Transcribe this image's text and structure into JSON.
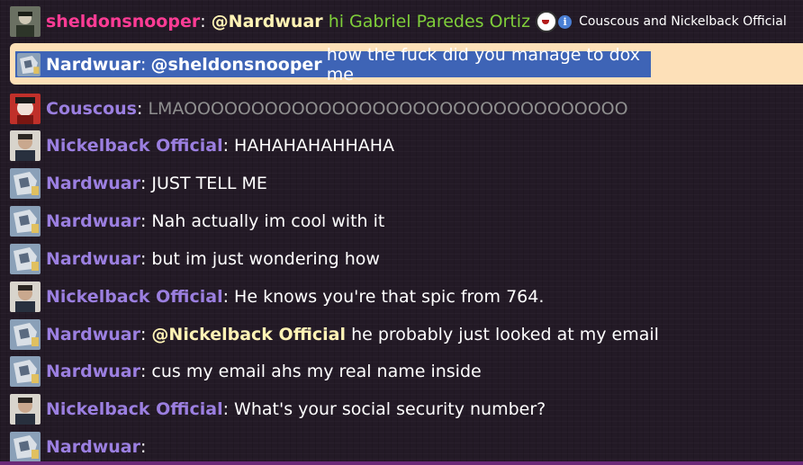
{
  "messages": [
    {
      "user": "sheldonsnooper",
      "mention": "@Nardwuar",
      "text": "hi Gabriel Paredes Ortiz",
      "note": "Couscous and Nickelback Official",
      "avatar_icon": "profile-avatar-icon",
      "emoji_icon": "laughing-emoji-icon",
      "info_icon": "info-badge-icon"
    },
    {
      "user": "Nardwuar",
      "mention": "@sheldonsnooper",
      "text": "how the fuck did you manage to dox me",
      "selected": true,
      "reply_bg": "#fde0b8",
      "highlight": "#3e64b6"
    },
    {
      "user": "Couscous",
      "text": "LMAOOOOOOOOOOOOOOOOOOOOOOOOOOOOOOOOO"
    },
    {
      "user": "Nickelback Official",
      "text": "HAHAHAHAHHAHA"
    },
    {
      "user": "Nardwuar",
      "text": "JUST TELL ME"
    },
    {
      "user": "Nardwuar",
      "text": "Nah actually im cool with it"
    },
    {
      "user": "Nardwuar",
      "text": "but im just wondering how"
    },
    {
      "user": "Nickelback Official",
      "text": "He knows you're that spic from 764."
    },
    {
      "user": "Nardwuar",
      "mention": "@Nickelback Official",
      "text": "he probably just looked at my email"
    },
    {
      "user": "Nardwuar",
      "text": "cus my email ahs my real name inside"
    },
    {
      "user": "Nickelback Official",
      "text": "What's your social security number?"
    },
    {
      "user": "Nardwuar",
      "text": ""
    }
  ],
  "colon": ":",
  "colors": {
    "background": "#231a26",
    "username": "#9b7fe0",
    "sheldon_username": "#ff3c95",
    "mention": "#fff3b5",
    "green_text": "#7fcf3a",
    "gray_text": "#8f8f8f",
    "bottom_bar": "#6b2a78"
  }
}
